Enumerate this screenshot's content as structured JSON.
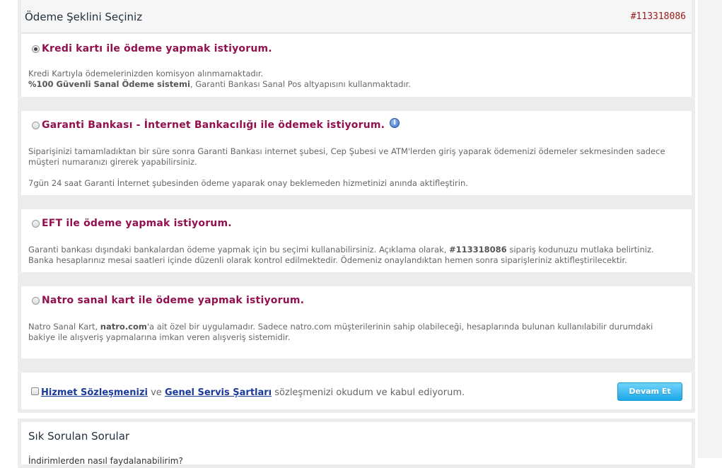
{
  "header": {
    "title": "Ödeme Şeklini Seçiniz",
    "order_no": "#113318086"
  },
  "options": [
    {
      "label": "Kredi kartı ile ödeme yapmak istiyorum.",
      "checked": true,
      "desc_1": "Kredi Kartıyla ödemelerinizden komisyon alınmamaktadır.",
      "desc_2_bold": "%100 Güvenli Sanal Ödeme sistemi",
      "desc_2_rest": ", Garanti Bankası Sanal Pos altyapısını kullanmaktadır."
    },
    {
      "label": "Garanti Bankası - İnternet Bankacılığı ile ödemek istiyorum.",
      "checked": false,
      "info_icon": "i",
      "desc_1": "Siparişinizi tamamladıktan bir süre sonra Garanti Bankası internet şubesi, Cep Şubesi ve ATM'lerden giriş yaparak ödemenizi ödemeler sekmesinden sadece müşteri numaranızı girerek yapabilirsiniz.",
      "desc_2": "7gün 24 saat Garanti İnternet şubesinden ödeme yaparak onay beklemeden hizmetinizi anında aktifleştirin."
    },
    {
      "label": "EFT ile ödeme yapmak istiyorum.",
      "checked": false,
      "desc_a": "Garanti bankası dışındaki bankalardan ödeme yapmak için bu seçimi kullanabilirsiniz. Açıklama olarak, ",
      "desc_b_bold": "#113318086",
      "desc_c": " sipariş kodunuzu mutlaka belirtiniz.",
      "desc_d": "Banka hesaplarınız mesai saatleri içinde düzenli olarak kontrol edilmektedir. Ödemeniz onaylandıktan hemen sonra siparişleriniz aktifleştirilecektir."
    },
    {
      "label": "Natro sanal kart ile ödeme yapmak istiyorum.",
      "checked": false,
      "desc_a": "Natro Sanal Kart, ",
      "desc_b_bold": "natro.com",
      "desc_c": "'a ait özel bir uygulamadır. Sadece natro.com müşterilerinin sahip olabileceği, hesaplarında bulunan kullanılabilir durumdaki bakiye ile alışveriş yapmalarına imkan veren alışveriş sistemidir."
    }
  ],
  "agreement": {
    "link_1": " Hizmet Sözleşmenizi",
    "connector": " ve ",
    "link_2": "Genel Servis Şartları",
    "rest": " sözleşmenizi okudum ve kabul ediyorum.",
    "button": "Devam Et"
  },
  "faq": {
    "title": "Sık Sorulan Sorular",
    "first_question": "İndirimlerden nasıl faydalanabilirim?"
  },
  "colors": {
    "accent": "#93104f",
    "order_no": "#9b1a1a",
    "button": "#1ca8e8",
    "link": "#1a3a9a"
  }
}
